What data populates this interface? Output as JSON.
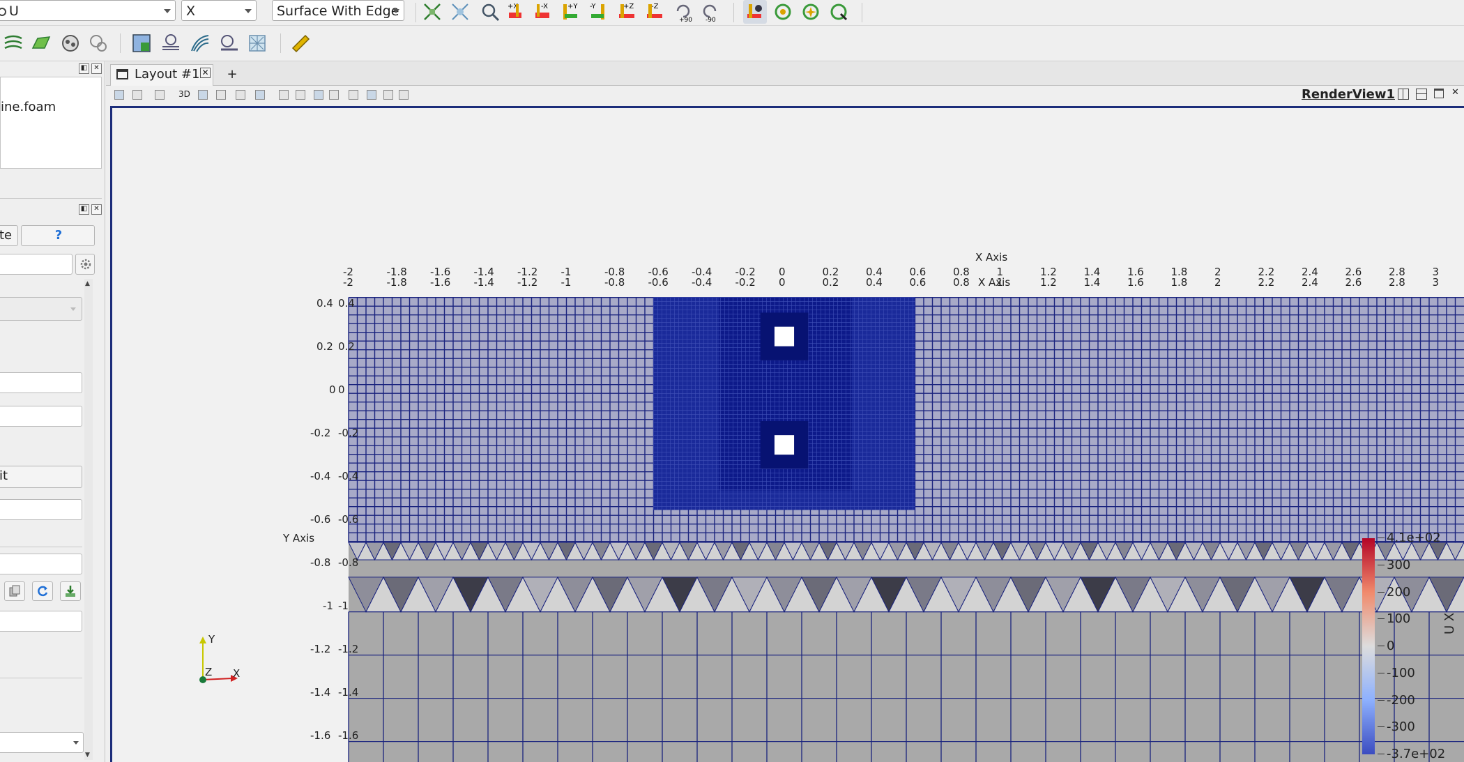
{
  "toolbar": {
    "variable_select": "U",
    "component_select": "X",
    "representation_select": "Surface With Edge",
    "camera_buttons": [
      "+X",
      "-X",
      "+Y",
      "-Y",
      "+Z",
      "-Z"
    ],
    "rotate_labels": [
      "+90",
      "-90"
    ]
  },
  "pipeline_browser": {
    "item": "ine.foam"
  },
  "properties_panel": {
    "apply_label": "te",
    "help_label": "?",
    "button_label": "it"
  },
  "layout": {
    "tab_label": "Layout #1",
    "add_tab": "+",
    "view_name": "RenderView1",
    "mode_3d": "3D"
  },
  "render": {
    "x_axis_title": "X Axis",
    "y_axis_title": "Y Axis",
    "x_ticks": [
      "-2",
      "-1.8",
      "-1.6",
      "-1.4",
      "-1.2",
      "-1",
      "-0.8",
      "-0.6",
      "-0.4",
      "-0.2",
      "0",
      "0.2",
      "0.4",
      "0.6",
      "0.8",
      "1",
      "1.2",
      "1.4",
      "1.6",
      "1.8",
      "2",
      "2.2",
      "2.4",
      "2.6",
      "2.8",
      "3"
    ],
    "y_ticks": [
      "0.4",
      "0.2",
      "0",
      "-0.2",
      "-0.4",
      "-0.6",
      "-0.8",
      "-1",
      "-1.2",
      "-1.4",
      "-1.6"
    ],
    "orientation_axes": {
      "y": "Y",
      "z": "Z",
      "x": "X"
    }
  },
  "colorbar": {
    "title": "U X",
    "labels": [
      "4.1e+02",
      "300",
      "200",
      "100",
      "0",
      "-100",
      "-200",
      "-300",
      "-3.7e+02"
    ],
    "colors": {
      "top": "#b40426",
      "mid": "#dddddd",
      "bottom": "#3b4cc0"
    }
  },
  "colors": {
    "mesh_dark": "#0d1a8a",
    "mesh_line": "#1a237e",
    "gray_fill": "#a9a9a9",
    "frame": "#1c2d7a"
  }
}
